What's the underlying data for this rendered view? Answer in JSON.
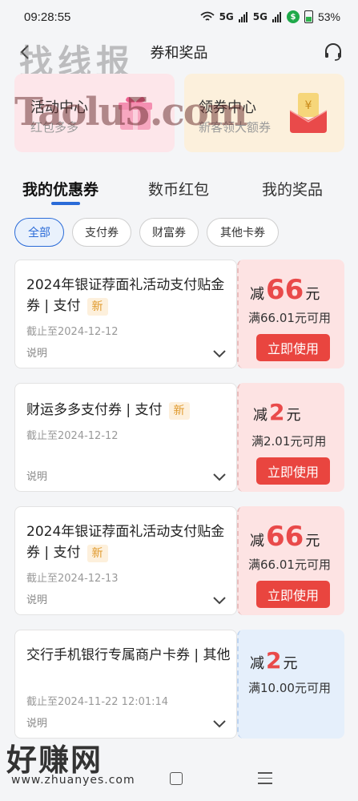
{
  "status_bar": {
    "time": "09:28:55",
    "network": "5G",
    "battery": "53%"
  },
  "nav": {
    "title": "券和奖品"
  },
  "watermarks": {
    "top": "找线报",
    "mid": "Taolu5.com",
    "bottom": "好赚网",
    "bottom_url": "www.zhuanyes.com"
  },
  "promos": [
    {
      "title": "活动中心",
      "subtitle": "红包多多"
    },
    {
      "title": "领券中心",
      "subtitle": "新客领大额券"
    }
  ],
  "tabs": [
    {
      "label": "我的优惠券",
      "active": true
    },
    {
      "label": "数币红包",
      "active": false
    },
    {
      "label": "我的奖品",
      "active": false
    }
  ],
  "chips": [
    {
      "label": "全部",
      "active": true
    },
    {
      "label": "支付券",
      "active": false
    },
    {
      "label": "财富券",
      "active": false
    },
    {
      "label": "其他卡券",
      "active": false
    }
  ],
  "coupons": [
    {
      "name": "2024年银证荐面礼活动支付贴金券 | 支付",
      "badge": "新",
      "expire": "截止至2024-12-12",
      "desc": "说明",
      "prefix": "减",
      "amount": "66",
      "unit": "元",
      "min_spend": "满66.01元可用",
      "button": "立即使用"
    },
    {
      "name": "财运多多支付券 | 支付",
      "badge": "新",
      "expire": "截止至2024-12-12",
      "desc": "说明",
      "prefix": "减",
      "amount": "2",
      "unit": "元",
      "min_spend": "满2.01元可用",
      "button": "立即使用"
    },
    {
      "name": "2024年银证荐面礼活动支付贴金券 | 支付",
      "badge": "新",
      "expire": "截止至2024-12-13",
      "desc": "说明",
      "prefix": "减",
      "amount": "66",
      "unit": "元",
      "min_spend": "满66.01元可用",
      "button": "立即使用"
    },
    {
      "name": "交行手机银行专属商户卡券 | 其他",
      "badge": "",
      "expire": "截止至2024-11-22 12:01:14",
      "desc": "说明",
      "prefix": "减",
      "amount": "2",
      "unit": "元",
      "min_spend": "满10.00元可用",
      "button": ""
    }
  ],
  "colors": {
    "accent": "#2a6bd8",
    "red": "#e94a4a",
    "button": "#e9453f"
  }
}
